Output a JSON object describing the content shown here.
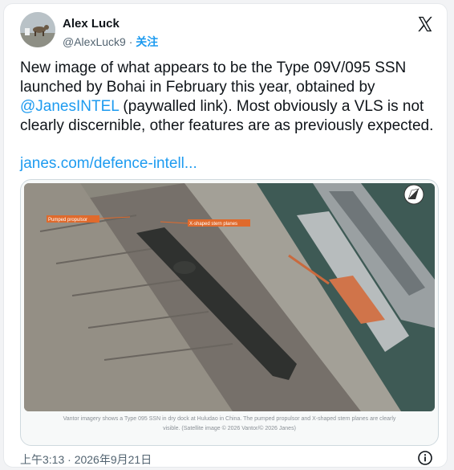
{
  "author": {
    "name": "Alex Luck",
    "handle": "@AlexLuck9",
    "separator": " · ",
    "follow_label": "关注"
  },
  "tweet": {
    "text_before": "New image of what appears to be the Type 09V/095 SSN launched by Bohai in February this year, obtained by ",
    "mention": "@JanesINTEL",
    "text_after": " (paywalled link). Most obviously a VLS is not clearly discernible, other features are as previously expected.",
    "link": "janes.com/defence-intell..."
  },
  "media": {
    "annotation_1": "Pumped propulsor",
    "annotation_2": "X-shaped stern planes",
    "caption_line_1": "Vantor imagery shows a Type 095 SSN in dry dock at Huludao in China. The pumped propulsor and X-shaped stern planes are clearly",
    "caption_line_2": "visible. (Satellite image © 2026 Vantor/© 2026 Janes)"
  },
  "footer": {
    "timestamp": "上午3:13 · 2026年9月21日"
  },
  "icons": {
    "logo": "x-logo-icon",
    "info": "info-icon",
    "compass": "north-arrow-icon"
  },
  "colors": {
    "accent": "#1d9bf0",
    "text": "#0f1419",
    "muted": "#536471"
  }
}
